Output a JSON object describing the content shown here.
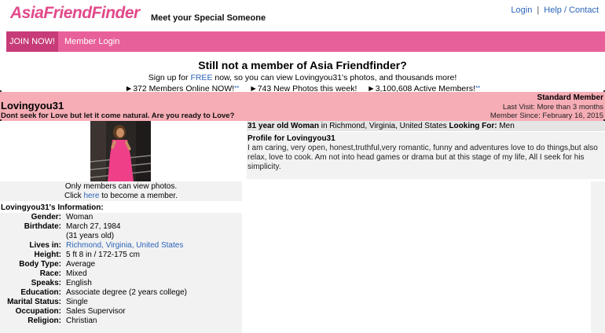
{
  "header": {
    "logo": "AsiaFriendFinder",
    "tagline": "Meet your Special Someone",
    "login": "Login",
    "separator": "|",
    "help": "Help / Contact"
  },
  "nav": {
    "join": "JOIN NOW!",
    "member_login": "Member Login"
  },
  "promo": {
    "title": "Still not a member of Asia Friendfinder?",
    "sub_before": "Sign up for ",
    "sub_link": "FREE",
    "sub_after": " now, so you can view Lovingyou31's photos, and thousands more!",
    "stat1": "►372 Members Online NOW!",
    "stat2": "►743 New Photos this week!",
    "stat3": "►3,100,608 Active Members!",
    "asterisk": "**"
  },
  "profile": {
    "username": "Lovingyou31",
    "headline": "Dont seek for Love but let it come natural. Are you ready to Love?",
    "member_type": "Standard Member",
    "last_visit": "Last Visit: More than 3 months",
    "member_since": "Member Since: February 16, 2015",
    "photo_note_1": "Only members can view photos.",
    "photo_note_click": "Click ",
    "photo_note_link": "here",
    "photo_note_end": " to become a member.",
    "summary_bold1": "31 year old Woman",
    "summary_mid": " in Richmond, Virginia, United States ",
    "summary_bold2": "Looking For:",
    "summary_end": " Men",
    "profile_title": "Profile for Lovingyou31",
    "profile_text": "I am caring, very open, honest,truthful,very romantic, funny and adventures love to do things,but also relax, love to cook. Am not into head games or drama but at this stage of my life, All I seek for his simplicity."
  },
  "info": {
    "heading": "Lovingyou31's Information:",
    "rows": [
      {
        "k": "Gender:",
        "v": "Woman"
      },
      {
        "k": "Birthdate:",
        "v": "March 27, 1984"
      },
      {
        "k": "",
        "v": "(31 years old)"
      },
      {
        "k": "Lives in:",
        "v": "Richmond, Virginia, United States"
      },
      {
        "k": "Height:",
        "v": "5 ft 8 in / 172-175 cm"
      },
      {
        "k": "Body Type:",
        "v": "Average"
      },
      {
        "k": "Race:",
        "v": "Mixed"
      },
      {
        "k": "Speaks:",
        "v": "English"
      },
      {
        "k": "Education:",
        "v": "Associate degree (2 years college)"
      },
      {
        "k": "Marital Status:",
        "v": "Single"
      },
      {
        "k": "Occupation:",
        "v": "Sales Supervisor"
      },
      {
        "k": "Religion:",
        "v": "Christian"
      }
    ]
  },
  "colors": {
    "brand_pink": "#e8609a",
    "band_pink": "#f6adb6",
    "link_blue": "#2b64b8"
  }
}
